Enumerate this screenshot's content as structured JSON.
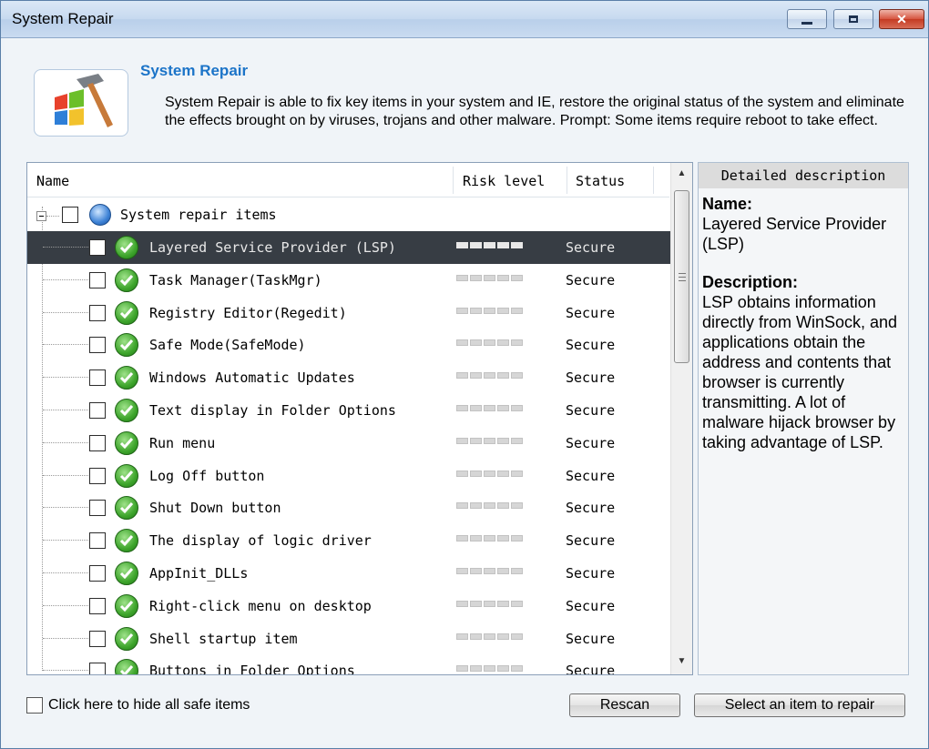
{
  "window": {
    "title": "System Repair"
  },
  "header": {
    "heading": "System Repair",
    "description": "System Repair is able to fix key items in your system and IE, restore the original status of the system and eliminate the effects brought on by viruses, trojans and other malware. Prompt: Some items require reboot to take effect."
  },
  "list": {
    "columns": {
      "name": "Name",
      "risk": "Risk level",
      "status": "Status"
    },
    "root": "System repair items",
    "items": [
      {
        "name": "Layered Service Provider (LSP)",
        "status": "Secure",
        "selected": true
      },
      {
        "name": "Task Manager(TaskMgr)",
        "status": "Secure"
      },
      {
        "name": "Registry Editor(Regedit)",
        "status": "Secure"
      },
      {
        "name": "Safe Mode(SafeMode)",
        "status": "Secure"
      },
      {
        "name": "Windows Automatic Updates",
        "status": "Secure"
      },
      {
        "name": "Text display in Folder Options",
        "status": "Secure"
      },
      {
        "name": "Run menu",
        "status": "Secure"
      },
      {
        "name": "Log Off button",
        "status": "Secure"
      },
      {
        "name": "Shut Down button",
        "status": "Secure"
      },
      {
        "name": "The display of logic driver",
        "status": "Secure"
      },
      {
        "name": "AppInit_DLLs",
        "status": "Secure"
      },
      {
        "name": "Right-click menu on desktop",
        "status": "Secure"
      },
      {
        "name": "Shell startup item",
        "status": "Secure"
      },
      {
        "name": "Buttons in Folder Options",
        "status": "Secure"
      }
    ]
  },
  "detail": {
    "title": "Detailed description",
    "name_label": "Name:",
    "name_value": "Layered Service Provider (LSP)",
    "desc_label": "Description:",
    "desc_value": "LSP obtains information directly from WinSock, and applications obtain the address and contents that browser is currently transmitting. A lot of malware hijack browser by taking advantage of LSP."
  },
  "footer": {
    "hide_safe_label": "Click here to hide all safe items",
    "rescan_label": "Rescan",
    "repair_label": "Select an item to repair"
  },
  "colors": {
    "accent": "#1c74c8",
    "selected_row": "#373d44",
    "secure_check": "#3ea52c"
  }
}
